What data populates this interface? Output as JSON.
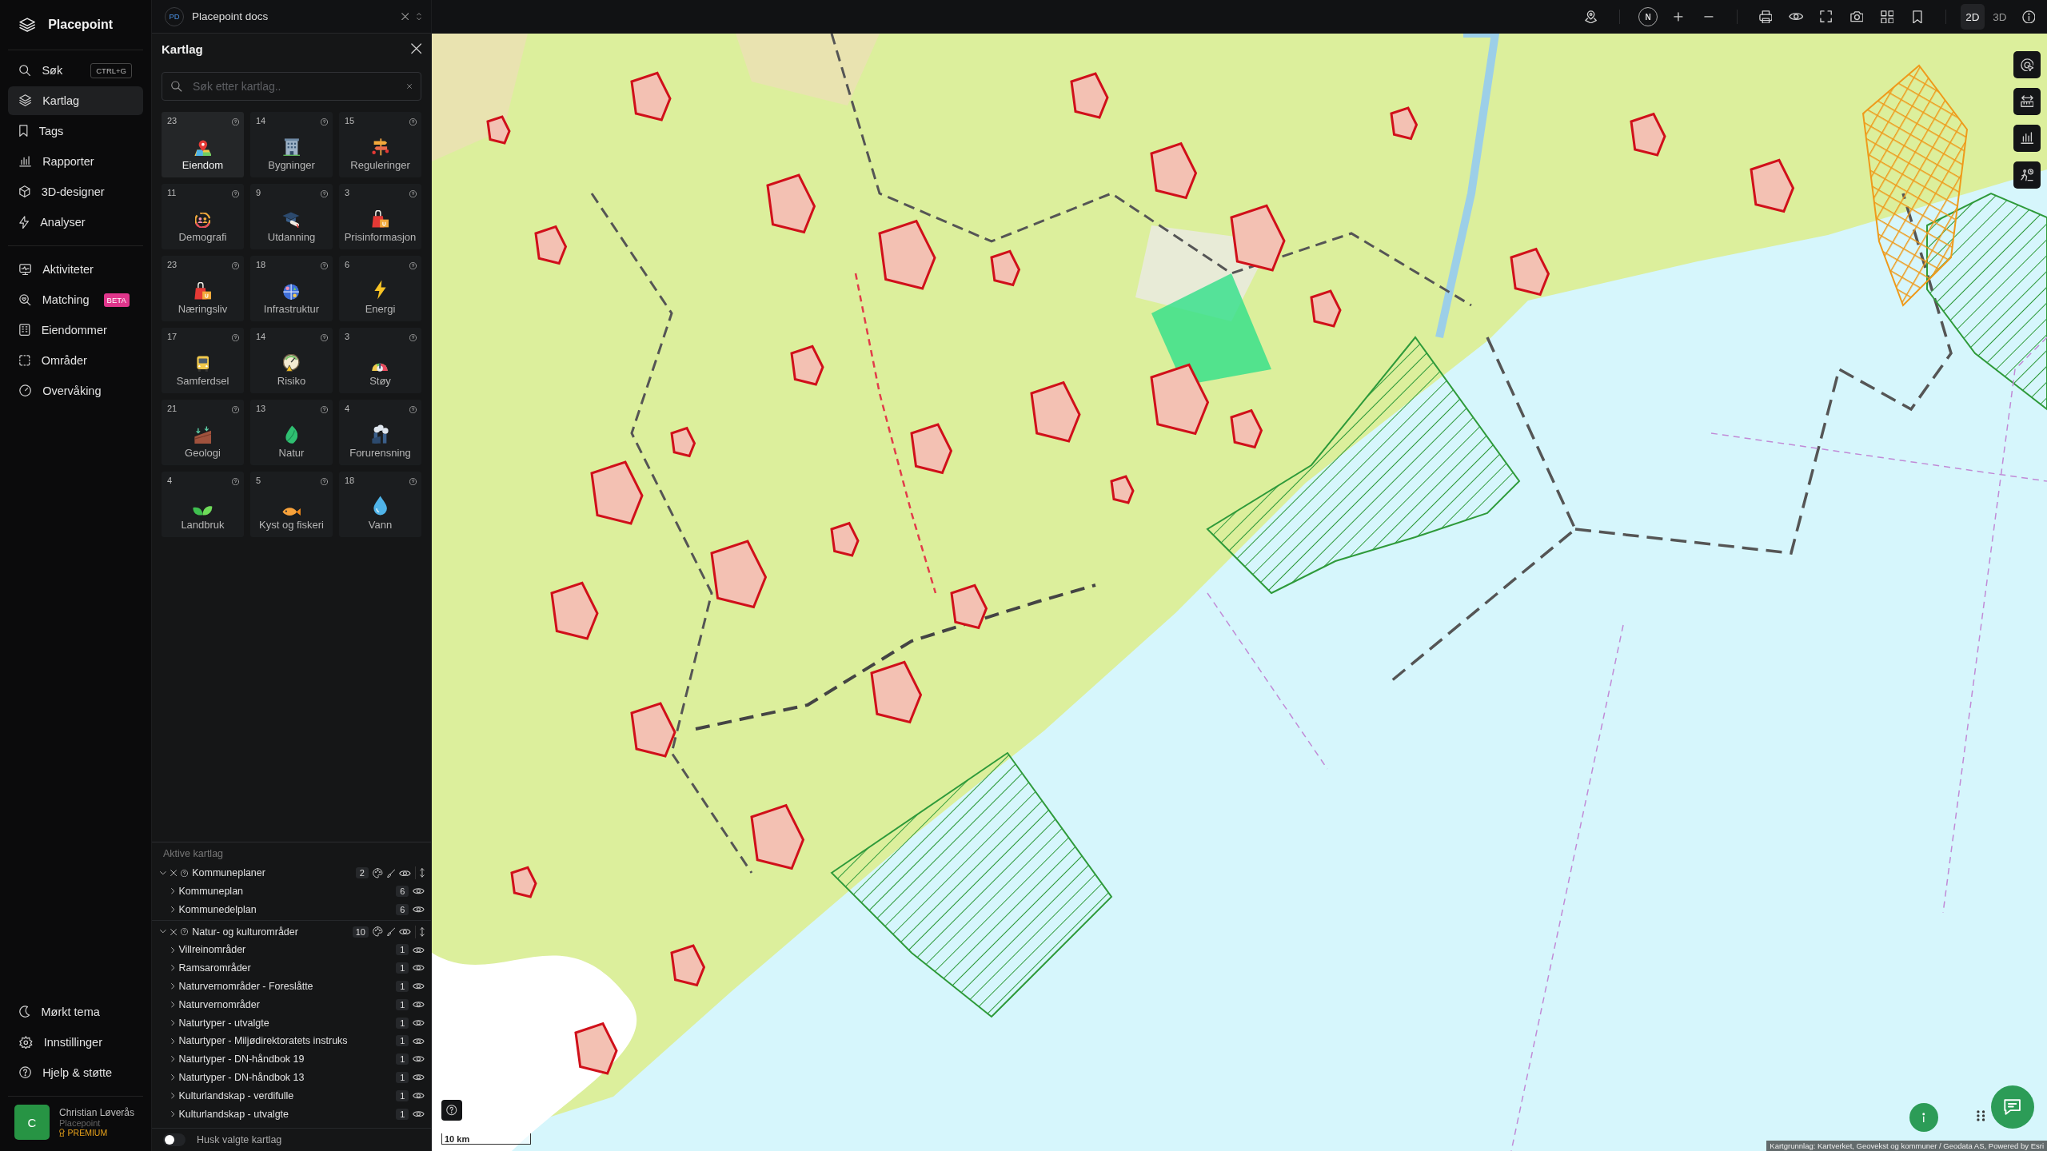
{
  "app": {
    "name": "Placepoint"
  },
  "nav": {
    "primary": [
      {
        "label": "Søk",
        "shortcut": "CTRL+G",
        "selected": false
      },
      {
        "label": "Kartlag",
        "selected": true
      },
      {
        "label": "Tags",
        "selected": false
      },
      {
        "label": "Rapporter",
        "selected": false
      },
      {
        "label": "3D-designer",
        "selected": false
      },
      {
        "label": "Analyser",
        "selected": false
      }
    ],
    "secondary": [
      {
        "label": "Aktiviteter",
        "selected": false
      },
      {
        "label": "Matching",
        "badge": "BETA",
        "selected": false
      },
      {
        "label": "Eiendommer",
        "selected": false
      },
      {
        "label": "Områder",
        "selected": false
      },
      {
        "label": "Overvåking",
        "selected": false
      }
    ],
    "footer": [
      {
        "label": "Mørkt tema"
      },
      {
        "label": "Innstillinger"
      },
      {
        "label": "Hjelp & støtte"
      }
    ]
  },
  "user": {
    "initial": "C",
    "name": "Christian Løverås",
    "org": "Placepoint",
    "plan": "PREMIUM"
  },
  "workspace_tab": {
    "initials": "PD",
    "title": "Placepoint docs"
  },
  "panel": {
    "title": "Kartlag",
    "search": {
      "placeholder": "Søk etter kartlag.."
    },
    "categories": [
      {
        "count": "23",
        "label": "Eiendom",
        "selected": true
      },
      {
        "count": "14",
        "label": "Bygninger",
        "selected": false
      },
      {
        "count": "15",
        "label": "Reguleringer",
        "selected": false
      },
      {
        "count": "11",
        "label": "Demografi",
        "selected": false
      },
      {
        "count": "9",
        "label": "Utdanning",
        "selected": false
      },
      {
        "count": "3",
        "label": "Prisinformasjon",
        "selected": false
      },
      {
        "count": "23",
        "label": "Næringsliv",
        "selected": false
      },
      {
        "count": "18",
        "label": "Infrastruktur",
        "selected": false
      },
      {
        "count": "6",
        "label": "Energi",
        "selected": false
      },
      {
        "count": "17",
        "label": "Samferdsel",
        "selected": false
      },
      {
        "count": "14",
        "label": "Risiko",
        "selected": false
      },
      {
        "count": "3",
        "label": "Støy",
        "selected": false
      },
      {
        "count": "21",
        "label": "Geologi",
        "selected": false
      },
      {
        "count": "13",
        "label": "Natur",
        "selected": false
      },
      {
        "count": "4",
        "label": "Forurensning",
        "selected": false
      },
      {
        "count": "4",
        "label": "Landbruk",
        "selected": false
      },
      {
        "count": "5",
        "label": "Kyst og fiskeri",
        "selected": false
      },
      {
        "count": "18",
        "label": "Vann",
        "selected": false
      }
    ]
  },
  "active_layers": {
    "title": "Aktive kartlag",
    "groups": [
      {
        "name": "Kommuneplaner",
        "count": "2",
        "expanded": true,
        "visible": true,
        "children": [
          {
            "name": "Kommuneplan",
            "count": "6",
            "expanded": false,
            "visible": true
          },
          {
            "name": "Kommunedelplan",
            "count": "6",
            "expanded": false,
            "visible": true
          }
        ]
      },
      {
        "name": "Natur- og kulturområder",
        "count": "10",
        "expanded": true,
        "visible": true,
        "children": [
          {
            "name": "Villreinområder",
            "count": "1",
            "expanded": false,
            "visible": true
          },
          {
            "name": "Ramsarområder",
            "count": "1",
            "expanded": false,
            "visible": true
          },
          {
            "name": "Naturvernområder - Foreslåtte",
            "count": "1",
            "expanded": false,
            "visible": true
          },
          {
            "name": "Naturvernområder",
            "count": "1",
            "expanded": false,
            "visible": true
          },
          {
            "name": "Naturtyper - utvalgte",
            "count": "1",
            "expanded": false,
            "visible": true
          },
          {
            "name": "Naturtyper - Miljødirektoratets instruks",
            "count": "1",
            "expanded": false,
            "visible": true
          },
          {
            "name": "Naturtyper - DN-håndbok 19",
            "count": "1",
            "expanded": false,
            "visible": true
          },
          {
            "name": "Naturtyper - DN-håndbok 13",
            "count": "1",
            "expanded": false,
            "visible": true
          },
          {
            "name": "Kulturlandskap - verdifulle",
            "count": "1",
            "expanded": false,
            "visible": true
          },
          {
            "name": "Kulturlandskap - utvalgte",
            "count": "1",
            "expanded": false,
            "visible": true
          }
        ]
      }
    ]
  },
  "remember": {
    "label": "Husk valgte kartlag",
    "on": false
  },
  "toolbar": {
    "compass": "N",
    "view_modes": [
      {
        "label": "2D",
        "selected": true
      },
      {
        "label": "3D",
        "selected": false
      }
    ]
  },
  "map": {
    "scale": "10 km",
    "attribution": "Kartgrunnlag: Kartverket, Geovekst og kommuner / Geodata AS, Powered by Esri"
  }
}
